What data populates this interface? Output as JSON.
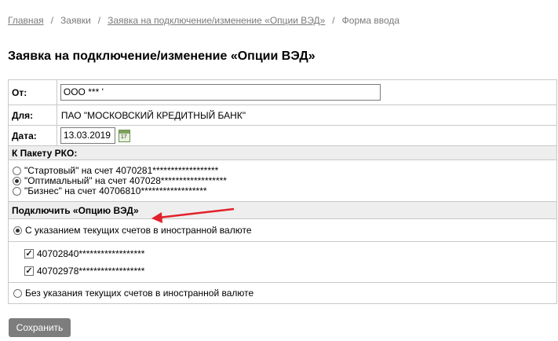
{
  "breadcrumb": {
    "home": "Главная",
    "requests": "Заявки",
    "current_request": "Заявка на подключение/изменение «Опции ВЭД»",
    "page": "Форма ввода",
    "separator": "/"
  },
  "page_title": "Заявка на подключение/изменение «Опции ВЭД»",
  "form": {
    "from_label": "От:",
    "from_value": "ООО ***  '",
    "to_label": "Для:",
    "to_value": "ПАО \"МОСКОВСКИЙ КРЕДИТНЫЙ БАНК\"",
    "date_label": "Дата:",
    "date_value": "13.03.2019",
    "calendar_day": "17",
    "package_header": "К Пакету РКО:",
    "packages": [
      {
        "label": "\"Стартовый\"  на счет 4070281******************",
        "selected": false
      },
      {
        "label": "\"Оптимальный\" на счет 407028******************",
        "selected": true
      },
      {
        "label": "\"Бизнес\"  на счет 40706810******************",
        "selected": false
      }
    ],
    "connect_header": "Подключить «Опцию ВЭД»",
    "with_accounts_label": "С указанием текущих счетов в иностранной валюте",
    "with_accounts_selected": true,
    "accounts": [
      {
        "label": "40702840******************",
        "checked": true
      },
      {
        "label": "40702978******************",
        "checked": true
      }
    ],
    "without_accounts_label": "Без указания текущих счетов в иностранной валюте",
    "without_accounts_selected": false
  },
  "save_button": "Сохранить",
  "colors": {
    "arrow": "#e2212a",
    "button": "#7d7d7d",
    "section_bg": "#eeeeee"
  }
}
